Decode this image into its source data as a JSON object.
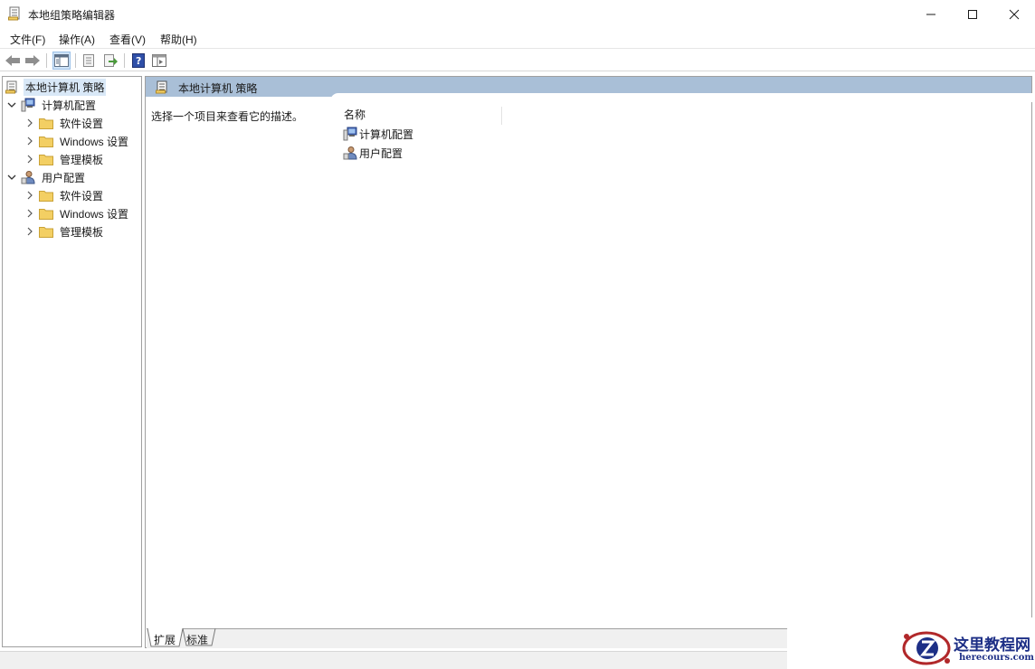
{
  "window": {
    "title": "本地组策略编辑器"
  },
  "menu": [
    "文件(F)",
    "操作(A)",
    "查看(V)",
    "帮助(H)"
  ],
  "toolbar": [
    "back-icon",
    "forward-icon",
    "show-tree-icon",
    "properties-icon",
    "export-list-icon",
    "help-icon",
    "console-tree-icon"
  ],
  "tree": {
    "root": "本地计算机 策略",
    "computer": {
      "label": "计算机配置",
      "children": [
        "软件设置",
        "Windows 设置",
        "管理模板"
      ]
    },
    "user": {
      "label": "用户配置",
      "children": [
        "软件设置",
        "Windows 设置",
        "管理模板"
      ]
    }
  },
  "detail": {
    "header": "本地计算机 策略",
    "description": "选择一个项目来查看它的描述。",
    "column_name": "名称",
    "items": [
      "计算机配置",
      "用户配置"
    ]
  },
  "tabs": [
    "扩展",
    "标准"
  ],
  "watermark": {
    "title": "这里教程网",
    "subtitle": "herecours.com"
  },
  "colors": {
    "header_bar": "#a9bfd7",
    "selection": "#d9e8f7",
    "folder": "#f3cf63",
    "watermark": "#1d2f86"
  }
}
